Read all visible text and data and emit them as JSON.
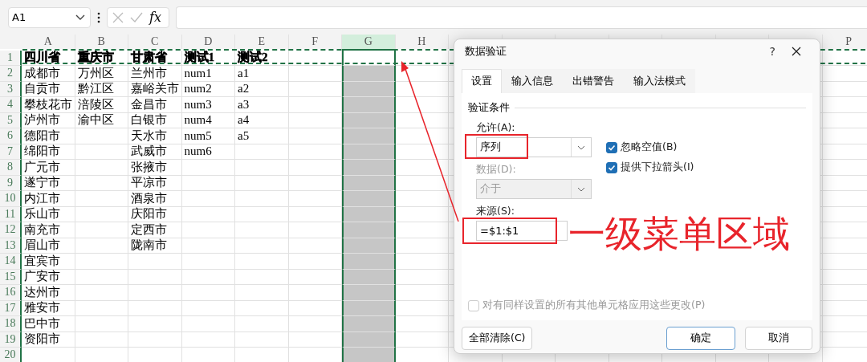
{
  "name_box": {
    "value": "A1"
  },
  "formula_bar": {
    "fx": "fx"
  },
  "sheet": {
    "columns": [
      {
        "label": "A",
        "selected": false
      },
      {
        "label": "B",
        "selected": false
      },
      {
        "label": "C",
        "selected": false
      },
      {
        "label": "D",
        "selected": false
      },
      {
        "label": "E",
        "selected": false
      },
      {
        "label": "F",
        "selected": false
      },
      {
        "label": "G",
        "selected": true
      },
      {
        "label": "H",
        "selected": false
      }
    ],
    "last_column": "P",
    "rows": [
      {
        "number": "1",
        "bold": true,
        "cells": {
          "A": "四川省",
          "B": "重庆市",
          "C": "甘肃省",
          "D": "测试1",
          "E": "测试2"
        }
      },
      {
        "number": "2",
        "bold": false,
        "cells": {
          "A": "成都市",
          "B": "万州区",
          "C": "兰州市",
          "D": "num1",
          "E": "a1"
        }
      },
      {
        "number": "3",
        "bold": false,
        "cells": {
          "A": "自贡市",
          "B": "黔江区",
          "C": "嘉峪关市",
          "D": "num2",
          "E": "a2"
        }
      },
      {
        "number": "4",
        "bold": false,
        "cells": {
          "A": "攀枝花市",
          "B": "涪陵区",
          "C": "金昌市",
          "D": "num3",
          "E": "a3"
        }
      },
      {
        "number": "5",
        "bold": false,
        "cells": {
          "A": "泸州市",
          "B": "渝中区",
          "C": "白银市",
          "D": "num4",
          "E": "a4"
        }
      },
      {
        "number": "6",
        "bold": false,
        "cells": {
          "A": "德阳市",
          "C": "天水市",
          "D": "num5",
          "E": "a5"
        }
      },
      {
        "number": "7",
        "bold": false,
        "cells": {
          "A": "绵阳市",
          "C": "武威市",
          "D": "num6"
        }
      },
      {
        "number": "8",
        "bold": false,
        "cells": {
          "A": "广元市",
          "C": "张掖市"
        }
      },
      {
        "number": "9",
        "bold": false,
        "cells": {
          "A": "遂宁市",
          "C": "平凉市"
        }
      },
      {
        "number": "10",
        "bold": false,
        "cells": {
          "A": "内江市",
          "C": "酒泉市"
        }
      },
      {
        "number": "11",
        "bold": false,
        "cells": {
          "A": "乐山市",
          "C": "庆阳市"
        }
      },
      {
        "number": "12",
        "bold": false,
        "cells": {
          "A": "南充市",
          "C": "定西市"
        }
      },
      {
        "number": "13",
        "bold": false,
        "cells": {
          "A": "眉山市",
          "C": "陇南市"
        }
      },
      {
        "number": "14",
        "bold": false,
        "cells": {
          "A": "宜宾市"
        }
      },
      {
        "number": "15",
        "bold": false,
        "cells": {
          "A": "广安市"
        }
      },
      {
        "number": "16",
        "bold": false,
        "cells": {
          "A": "达州市"
        }
      },
      {
        "number": "17",
        "bold": false,
        "cells": {
          "A": "雅安市"
        }
      },
      {
        "number": "18",
        "bold": false,
        "cells": {
          "A": "巴中市"
        }
      },
      {
        "number": "19",
        "bold": false,
        "cells": {
          "A": "资阳市"
        }
      },
      {
        "number": "20",
        "cells": {}
      }
    ]
  },
  "dialog": {
    "title": "数据验证",
    "help": "?",
    "tabs": [
      {
        "label": "设置",
        "selected": true
      },
      {
        "label": "输入信息",
        "selected": false
      },
      {
        "label": "出错警告",
        "selected": false
      },
      {
        "label": "输入法模式",
        "selected": false
      }
    ],
    "section": "验证条件",
    "allow": {
      "label": "允许(A):",
      "value": "序列"
    },
    "options": [
      {
        "label": "忽略空值(B)",
        "checked": true
      },
      {
        "label": "提供下拉箭头(I)",
        "checked": true
      }
    ],
    "data": {
      "label": "数据(D):",
      "value": "介于",
      "disabled": true
    },
    "source": {
      "label": "来源(S):",
      "value": "=$1:$1"
    },
    "apply_all": {
      "label": "对有同样设置的所有其他单元格应用这些更改(P)",
      "checked": false,
      "disabled": true
    },
    "buttons": [
      {
        "label": "全部清除(C)",
        "kind": "plain"
      },
      {
        "label": "确定",
        "kind": "primary"
      },
      {
        "label": "取消",
        "kind": "plain"
      }
    ]
  },
  "annotation": {
    "text": "一级菜单区域"
  }
}
